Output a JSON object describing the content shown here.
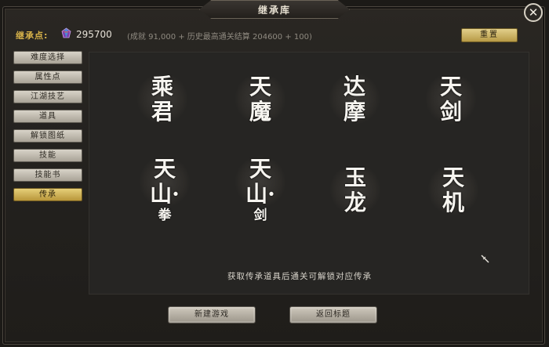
{
  "window": {
    "title": "继承库",
    "close_label": "✕"
  },
  "points": {
    "label": "继承点:",
    "value": "295700",
    "formula": "(成就 91,000 + 历史最高通关结算 204600 + 100)"
  },
  "reset_label": "重置",
  "sidebar": {
    "items": [
      {
        "label": "难度选择"
      },
      {
        "label": "属性点"
      },
      {
        "label": "江湖技艺"
      },
      {
        "label": "道具"
      },
      {
        "label": "解锁图纸"
      },
      {
        "label": "技能"
      },
      {
        "label": "技能书"
      },
      {
        "label": "传承"
      }
    ],
    "active_index": 7
  },
  "legacies": [
    {
      "line1": "乘",
      "line2": "君",
      "sub": ""
    },
    {
      "line1": "天",
      "line2": "魔",
      "sub": ""
    },
    {
      "line1": "达",
      "line2": "摩",
      "sub": ""
    },
    {
      "line1": "天",
      "line2": "剑",
      "sub": ""
    },
    {
      "line1": "天",
      "line2": "山·",
      "sub": "拳"
    },
    {
      "line1": "天",
      "line2": "山·",
      "sub": "剑"
    },
    {
      "line1": "玉",
      "line2": "龙",
      "sub": ""
    },
    {
      "line1": "天",
      "line2": "机",
      "sub": ""
    }
  ],
  "hint": "获取传承道具后通关可解锁对应传承",
  "buttons": {
    "new_game": "新建游戏",
    "return_title": "返回标题"
  },
  "colors": {
    "accent_gold": "#d9b44a",
    "panel": "#262523"
  },
  "icons": {
    "points": "gem-icon",
    "close": "close-icon",
    "cursor": "sword-cursor-icon"
  }
}
